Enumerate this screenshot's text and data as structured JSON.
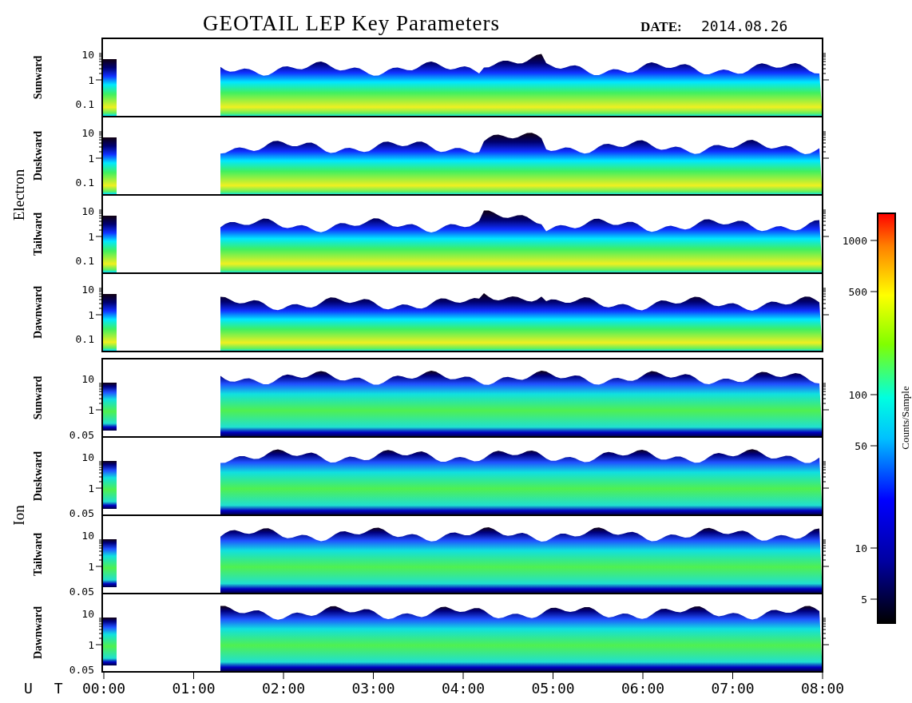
{
  "title": "GEOTAIL LEP Key Parameters",
  "date": {
    "label": "DATE:",
    "value": "2014.08.26"
  },
  "groups": [
    {
      "label": "Electron",
      "kind": "electron",
      "panels": [
        {
          "label": "Sunward",
          "yticks": [
            "10",
            "1",
            "0.1"
          ]
        },
        {
          "label": "Duskward",
          "yticks": [
            "10",
            "1",
            "0.1"
          ]
        },
        {
          "label": "Tailward",
          "yticks": [
            "10",
            "1",
            "0.1"
          ]
        },
        {
          "label": "Dawnward",
          "yticks": [
            "10",
            "1",
            "0.1"
          ]
        }
      ]
    },
    {
      "label": "Ion",
      "kind": "ion",
      "panels": [
        {
          "label": "Sunward",
          "yticks": [
            "10",
            "1",
            "0.05"
          ]
        },
        {
          "label": "Duskward",
          "yticks": [
            "10",
            "1",
            "0.05"
          ]
        },
        {
          "label": "Tailward",
          "yticks": [
            "10",
            "1",
            "0.05"
          ]
        },
        {
          "label": "Dawnward",
          "yticks": [
            "10",
            "1",
            "0.05"
          ]
        }
      ]
    }
  ],
  "time_axis": {
    "label": "U T",
    "ticks": [
      "00:00",
      "01:00",
      "02:00",
      "03:00",
      "04:00",
      "05:00",
      "06:00",
      "07:00",
      "08:00"
    ]
  },
  "colorbar": {
    "label": "Counts/Sample",
    "ticks": [
      "1000",
      "500",
      "100",
      "50",
      "10",
      "5"
    ]
  }
}
